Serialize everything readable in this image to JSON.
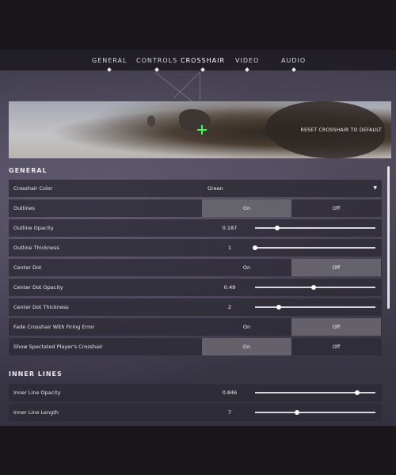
{
  "nav": {
    "tabs": [
      {
        "label": "GENERAL"
      },
      {
        "label": "CONTROLS"
      },
      {
        "label": "CROSSHAIR",
        "active": true
      },
      {
        "label": "VIDEO"
      },
      {
        "label": "AUDIO"
      }
    ]
  },
  "preview": {
    "reset_label": "RESET CROSSHAIR TO DEFAULT",
    "crosshair_color": "#3cff5a"
  },
  "general": {
    "title": "GENERAL",
    "crosshair_color": {
      "label": "Crosshair Color",
      "value": "Green"
    },
    "outlines": {
      "label": "Outlines",
      "on": "On",
      "off": "Off",
      "selected": "On"
    },
    "outline_opacity": {
      "label": "Outline Opacity",
      "value": "0.187",
      "fraction": 0.187
    },
    "outline_thickness": {
      "label": "Outline Thickness",
      "value": "1",
      "fraction": 0.0
    },
    "center_dot": {
      "label": "Center Dot",
      "on": "On",
      "off": "Off",
      "selected": "Off"
    },
    "center_dot_opacity": {
      "label": "Center Dot Opacity",
      "value": "0.49",
      "fraction": 0.49
    },
    "center_dot_thickness": {
      "label": "Center Dot Thickness",
      "value": "2",
      "fraction": 0.2
    },
    "fade_crosshair": {
      "label": "Fade Crosshair With Firing Error",
      "on": "On",
      "off": "Off",
      "selected": "Off"
    },
    "show_spectated": {
      "label": "Show Spectated Player's Crosshair",
      "on": "On",
      "off": "Off",
      "selected": "On"
    }
  },
  "inner_lines": {
    "title": "INNER LINES",
    "opacity": {
      "label": "Inner Line Opacity",
      "value": "0.846",
      "fraction": 0.846
    },
    "length": {
      "label": "Inner Line Length",
      "value": "7",
      "fraction": 0.35
    }
  },
  "colors": {
    "accent": "#3cff5a",
    "panel_row": "#2c2a34",
    "selected_toggle": "#78767e"
  }
}
